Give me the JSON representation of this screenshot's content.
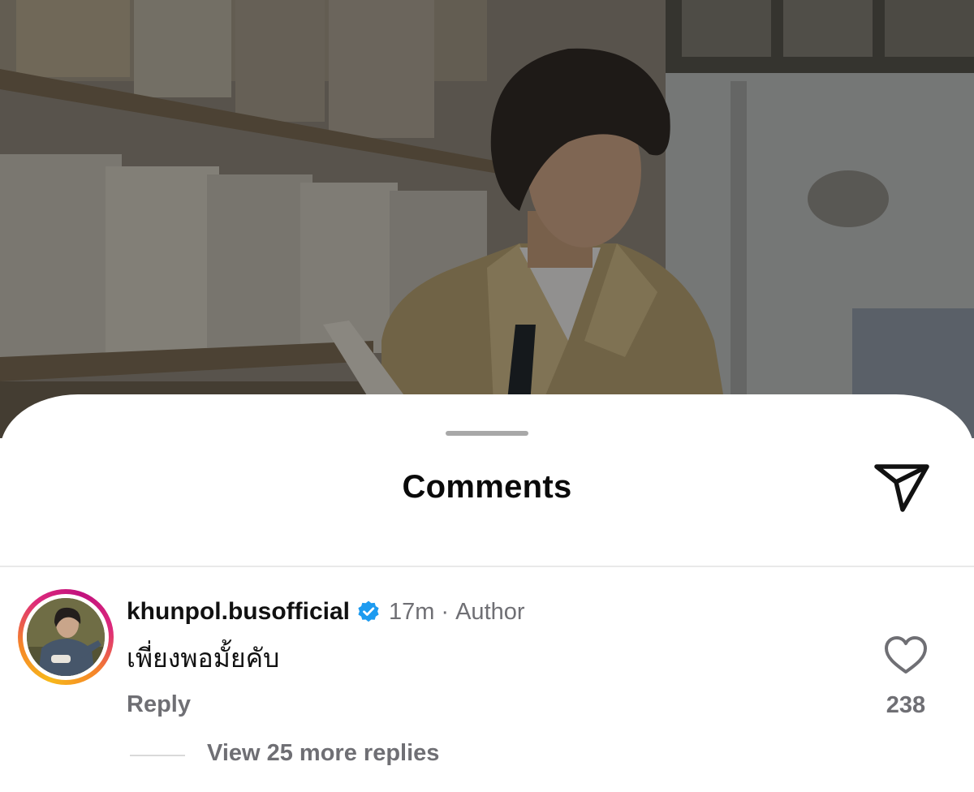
{
  "sheet": {
    "title": "Comments",
    "share_icon": "send-icon"
  },
  "comment": {
    "username": "khunpol.busofficial",
    "verified_icon": "verified-badge-icon",
    "time": "17m",
    "separator": "·",
    "role": "Author",
    "text": "เพี่ยงพอมั้ยคับ",
    "reply_label": "Reply",
    "like_icon": "heart-icon",
    "like_count": "238",
    "view_replies_label": "View 25 more replies"
  },
  "colors": {
    "verified": "#1d9bf0",
    "muted_text": "#6f6f74",
    "ring_start": "#f7b81a",
    "ring_end": "#dd2a7b"
  }
}
